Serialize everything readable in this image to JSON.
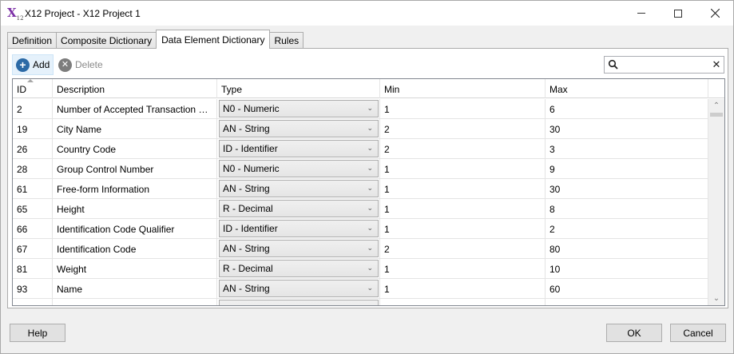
{
  "window": {
    "title": "X12 Project - X12 Project 1",
    "logo_text": "X",
    "logo_sub": "12"
  },
  "tabs": [
    {
      "label": "Definition",
      "active": false
    },
    {
      "label": "Composite Dictionary",
      "active": false
    },
    {
      "label": "Data Element Dictionary",
      "active": true
    },
    {
      "label": "Rules",
      "active": false
    }
  ],
  "toolbar": {
    "add_label": "Add",
    "delete_label": "Delete"
  },
  "search": {
    "value": "",
    "placeholder": ""
  },
  "grid": {
    "columns": [
      "ID",
      "Description",
      "Type",
      "Min",
      "Max"
    ],
    "rows": [
      {
        "id": "2",
        "description": "Number of Accepted Transaction S...",
        "type": "N0 - Numeric",
        "min": "1",
        "max": "6"
      },
      {
        "id": "19",
        "description": "City Name",
        "type": "AN - String",
        "min": "2",
        "max": "30"
      },
      {
        "id": "26",
        "description": "Country Code",
        "type": "ID - Identifier",
        "min": "2",
        "max": "3"
      },
      {
        "id": "28",
        "description": "Group Control Number",
        "type": "N0 - Numeric",
        "min": "1",
        "max": "9"
      },
      {
        "id": "61",
        "description": "Free-form Information",
        "type": "AN - String",
        "min": "1",
        "max": "30"
      },
      {
        "id": "65",
        "description": "Height",
        "type": "R - Decimal",
        "min": "1",
        "max": "8"
      },
      {
        "id": "66",
        "description": "Identification Code Qualifier",
        "type": "ID - Identifier",
        "min": "1",
        "max": "2"
      },
      {
        "id": "67",
        "description": "Identification Code",
        "type": "AN - String",
        "min": "2",
        "max": "80"
      },
      {
        "id": "81",
        "description": "Weight",
        "type": "R - Decimal",
        "min": "1",
        "max": "10"
      },
      {
        "id": "93",
        "description": "Name",
        "type": "AN - String",
        "min": "1",
        "max": "60"
      }
    ]
  },
  "buttons": {
    "help": "Help",
    "ok": "OK",
    "cancel": "Cancel"
  },
  "colors": {
    "logo": "#7b2fa6",
    "add_icon": "#2c6aa6",
    "delete_icon": "#7d7d7d"
  }
}
